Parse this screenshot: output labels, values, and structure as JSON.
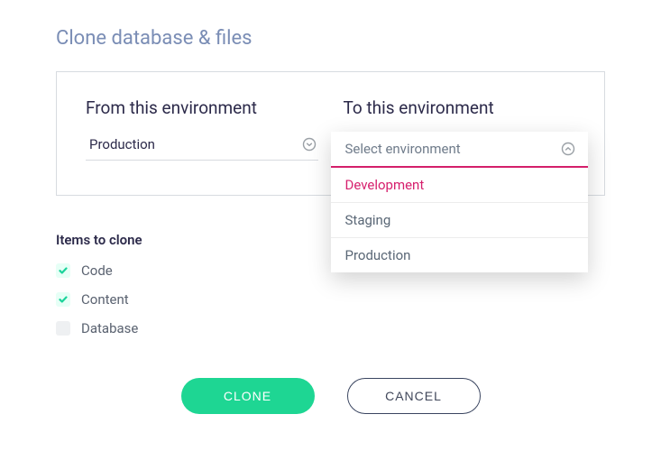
{
  "title": "Clone database & files",
  "from_env": {
    "label": "From this environment",
    "selected": "Production"
  },
  "to_env": {
    "label": "To this environment",
    "placeholder": "Select environment",
    "options": [
      {
        "label": "Development",
        "highlighted": true
      },
      {
        "label": "Staging",
        "highlighted": false
      },
      {
        "label": "Production",
        "highlighted": false
      }
    ]
  },
  "items": {
    "title": "Items to clone",
    "list": [
      {
        "label": "Code",
        "checked": true
      },
      {
        "label": "Content",
        "checked": true
      },
      {
        "label": "Database",
        "checked": false
      }
    ]
  },
  "actions": {
    "clone": "CLONE",
    "cancel": "CANCEL"
  }
}
